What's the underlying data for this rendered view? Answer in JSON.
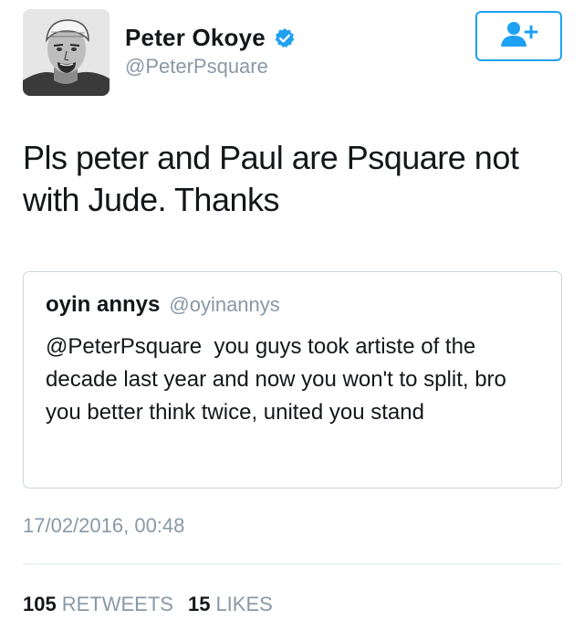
{
  "author": {
    "name": "Peter Okoye",
    "handle": "@PeterPsquare",
    "verified": true,
    "avatar_icon": "profile-photo"
  },
  "follow_button": {
    "icon": "add-user-icon",
    "color": "#1da1f2"
  },
  "tweet": {
    "text": "Pls peter and Paul are Psquare not with Jude. Thanks"
  },
  "quoted_tweet": {
    "name": "oyin annys",
    "handle": "@oyinannys",
    "text": "@PeterPsquare  you guys took artiste of the decade last year and now you won't to split, bro you better think twice, united you stand"
  },
  "timestamp": "17/02/2016, 00:48",
  "stats": {
    "retweets_count": "105",
    "retweets_label": "RETWEETS",
    "likes_count": "15",
    "likes_label": "LIKES"
  },
  "colors": {
    "accent": "#1da1f2",
    "secondary_text": "#8899a6",
    "border": "#ccd6dd"
  }
}
